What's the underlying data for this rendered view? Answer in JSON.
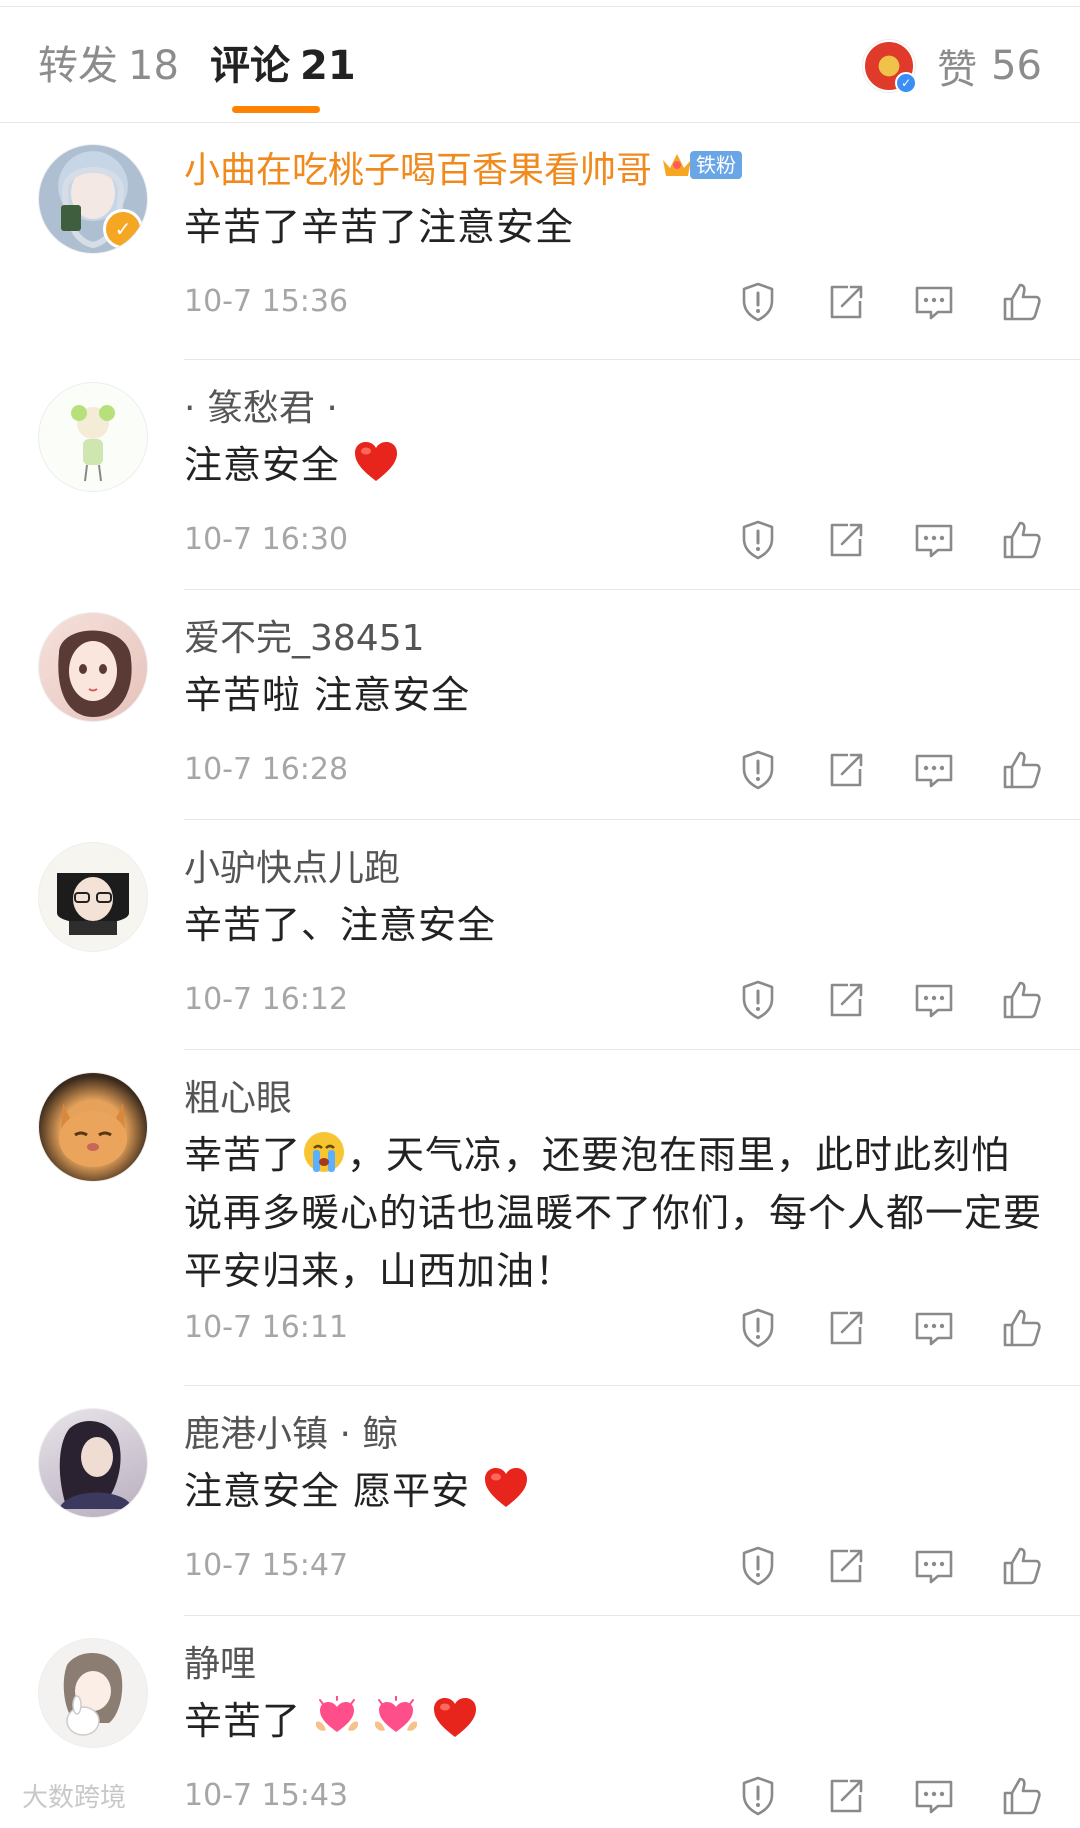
{
  "tabs": {
    "repost_label": "转发",
    "repost_count": "18",
    "comments_label": "评论",
    "comments_count": "21",
    "like_label": "赞",
    "like_count": "56"
  },
  "accent_color": "#ff8200",
  "comments": [
    {
      "username": "小曲在吃桃子喝百香果看帅哥",
      "badge": "铁粉",
      "text": "辛苦了辛苦了注意安全",
      "time": "10-7 15:36"
    },
    {
      "username": "· 篆愁君 ·",
      "text": "注意安全",
      "time": "10-7 16:30"
    },
    {
      "username": "爱不完_38451",
      "text": "辛苦啦 注意安全",
      "time": "10-7 16:28"
    },
    {
      "username": "小驴快点儿跑",
      "text": "辛苦了、注意安全",
      "time": "10-7 16:12"
    },
    {
      "username": "粗心眼",
      "text_part1": "幸苦了",
      "text_part2": "，天气凉，还要泡在雨里，此时此刻怕说再多暖心的话也温暖不了你们，每个人都一定要平安归来，山西加油！",
      "time": "10-7 16:11"
    },
    {
      "username": "鹿港小镇 · 鲸",
      "text": "注意安全 愿平安",
      "time": "10-7 15:47"
    },
    {
      "username": "静哩",
      "text": "辛苦了",
      "time": "10-7 15:43"
    }
  ],
  "watermark": "大数跨境",
  "icons": [
    "report-icon",
    "share-icon",
    "reply-icon",
    "like-icon",
    "heart-emoji",
    "crying-emoji",
    "heart-hands-emoji",
    "crown-icon",
    "verified-icon"
  ]
}
